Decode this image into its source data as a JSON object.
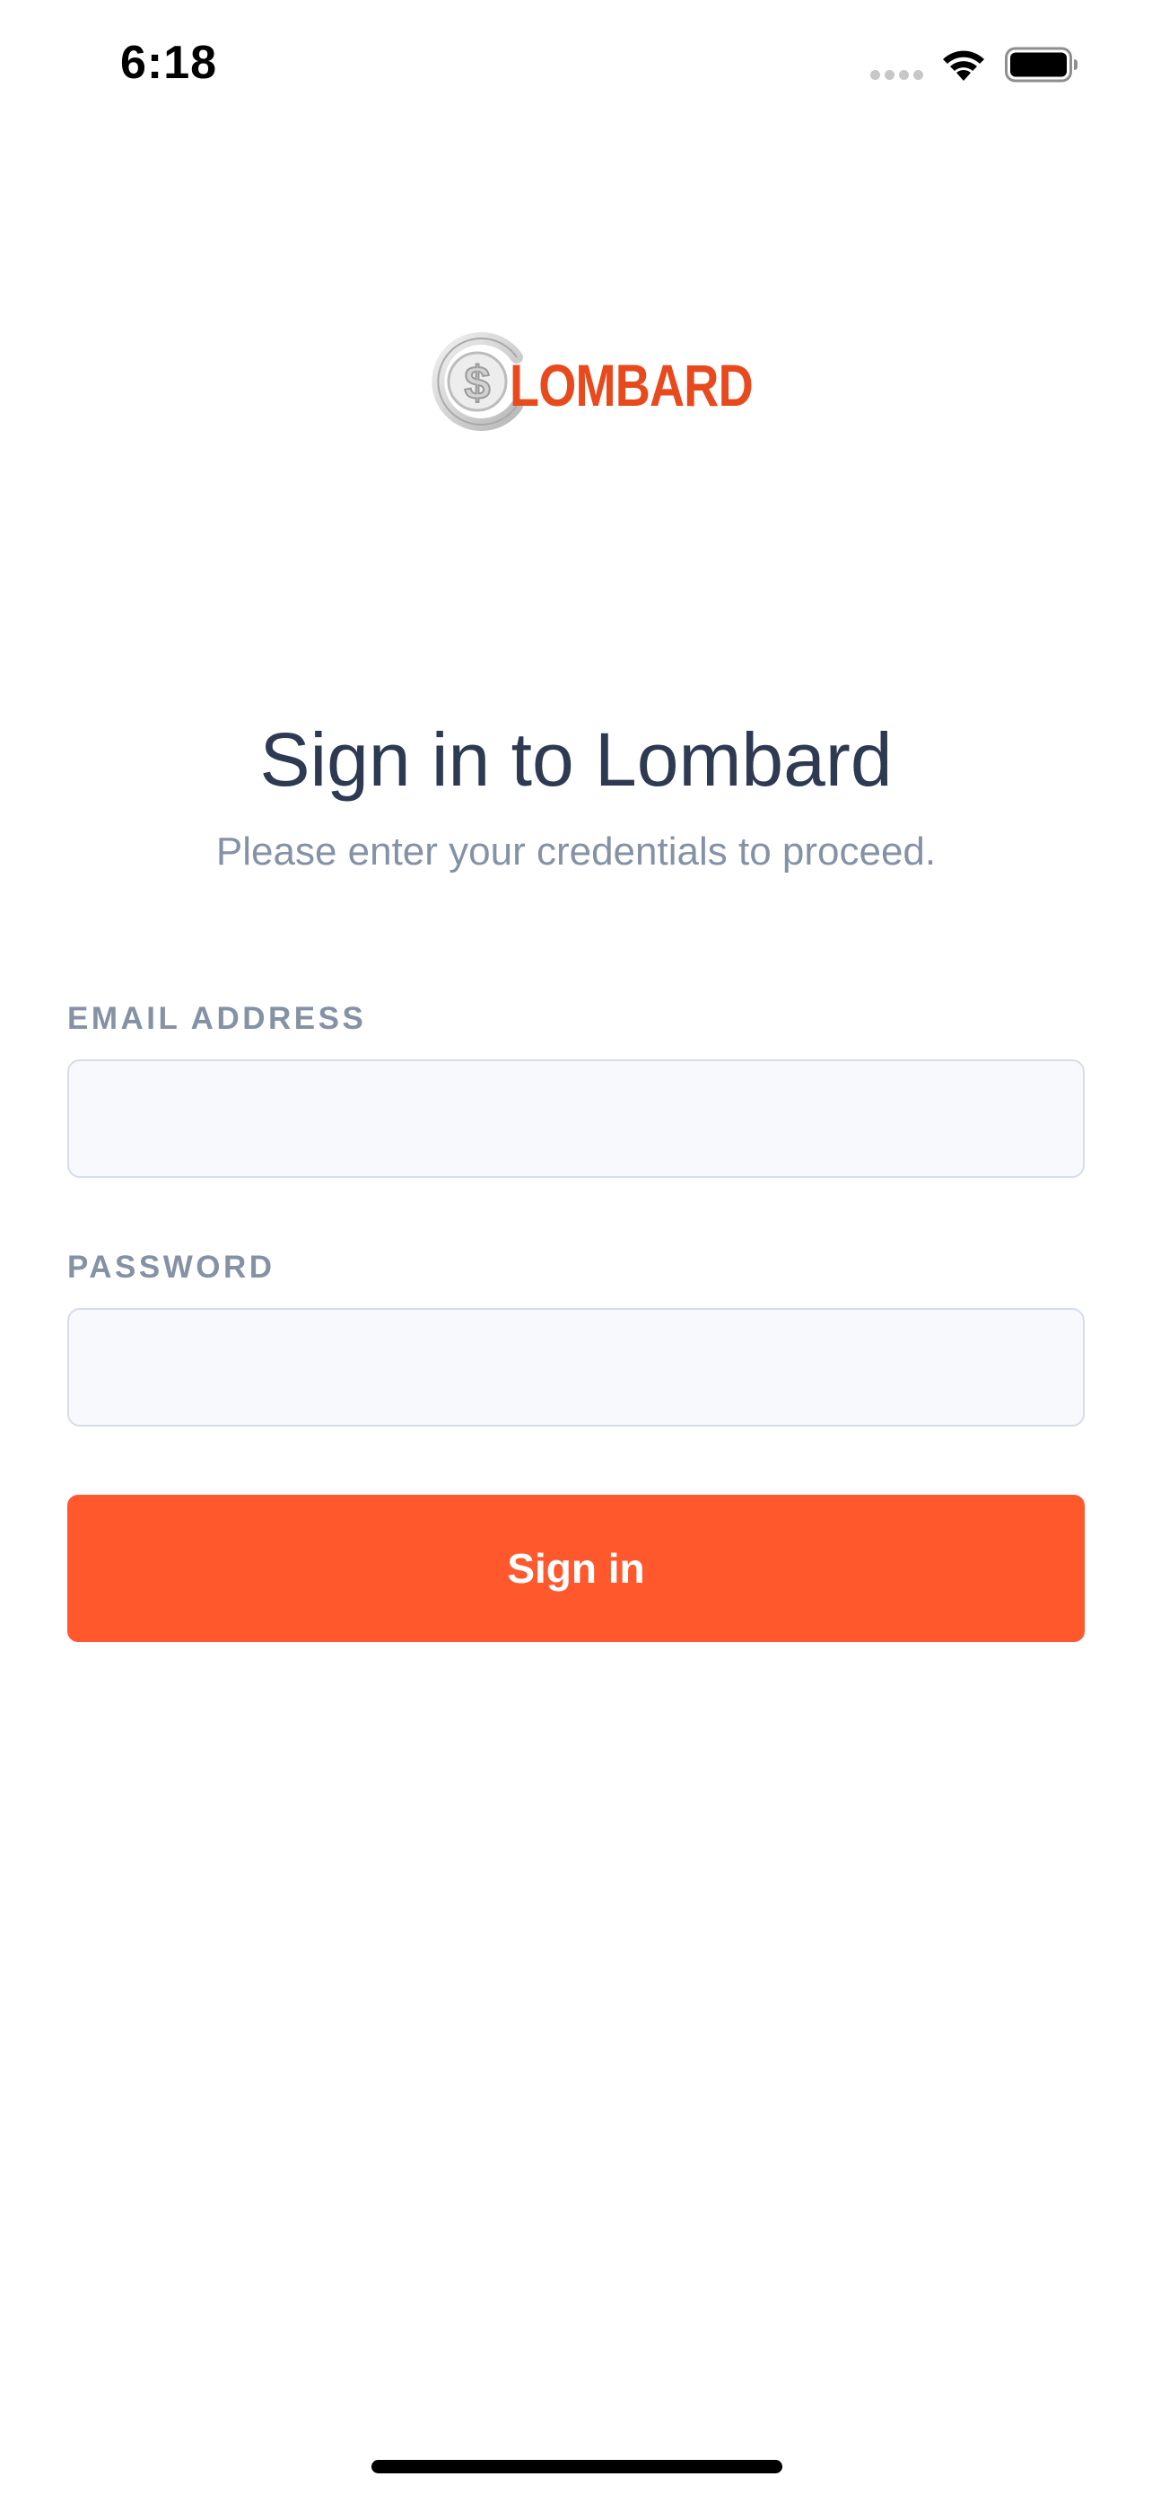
{
  "status_bar": {
    "time": "6:18",
    "signal_icon": "cellular-signal-icon",
    "wifi_icon": "wifi-icon",
    "battery_icon": "battery-icon"
  },
  "logo": {
    "text": "LOMBARD",
    "icon": "dollar-coin-icon",
    "color": "#e8491d"
  },
  "header": {
    "title": "Sign in to Lombard",
    "subtitle": "Please enter your credentials to proceed."
  },
  "form": {
    "email": {
      "label": "EMAIL ADDRESS",
      "value": "",
      "placeholder": ""
    },
    "password": {
      "label": "PASSWORD",
      "value": "",
      "placeholder": ""
    },
    "submit_label": "Sign in"
  },
  "colors": {
    "accent": "#ff582d",
    "title": "#2d3a52",
    "muted": "#8592a6",
    "input_bg": "#f7f9fd",
    "input_border": "#d6dde9"
  }
}
